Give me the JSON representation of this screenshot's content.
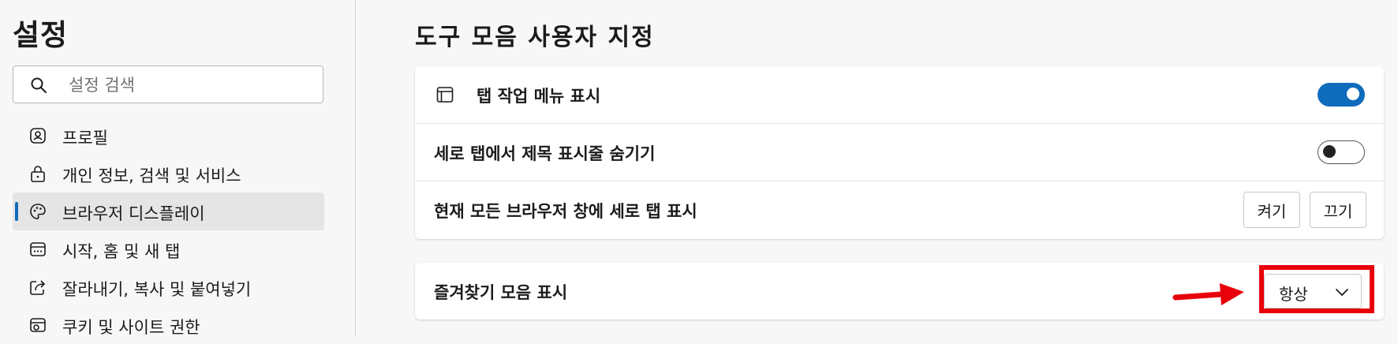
{
  "sidebar": {
    "title": "설정",
    "search": {
      "placeholder": "설정 검색",
      "value": ""
    },
    "items": [
      {
        "label": "프로필",
        "icon": "profile-icon",
        "active": false
      },
      {
        "label": "개인 정보, 검색 및 서비스",
        "icon": "lock-icon",
        "active": false
      },
      {
        "label": "브라우저 디스플레이",
        "icon": "palette-icon",
        "active": true
      },
      {
        "label": "시작, 홈 및 새 탭",
        "icon": "new-tab-icon",
        "active": false
      },
      {
        "label": "잘라내기, 복사 및 붙여넣기",
        "icon": "share-icon",
        "active": false
      },
      {
        "label": "쿠키 및 사이트 권한",
        "icon": "site-permissions-icon",
        "active": false
      }
    ]
  },
  "main": {
    "title": "도구 모음 사용자 지정",
    "card1": {
      "rows": [
        {
          "label": "탭 작업 메뉴 표시",
          "icon": "tab-actions-icon",
          "toggle": "on"
        },
        {
          "label": "세로 탭에서 제목 표시줄 숨기기",
          "toggle": "off"
        },
        {
          "label": "현재 모든 브라우저 창에 세로 탭 표시",
          "buttons": [
            "켜기",
            "끄기"
          ]
        }
      ]
    },
    "card2": {
      "rows": [
        {
          "label": "즐겨찾기 모음 표시",
          "dropdown": {
            "value": "항상"
          }
        }
      ]
    }
  },
  "colors": {
    "accent": "#0f6cbd",
    "annotation": "#e8000b"
  }
}
